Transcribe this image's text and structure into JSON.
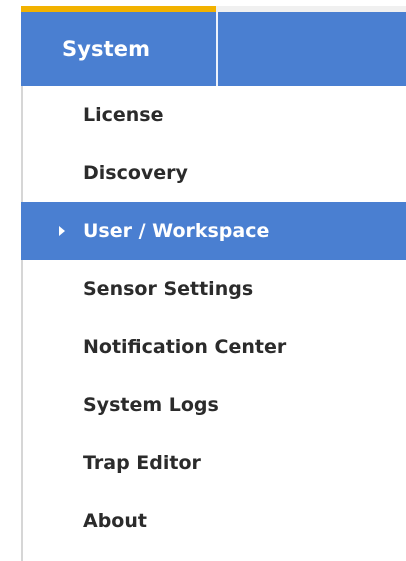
{
  "header": {
    "title": "System"
  },
  "menu": {
    "items": [
      {
        "label": "License",
        "active": false
      },
      {
        "label": "Discovery",
        "active": false
      },
      {
        "label": "User / Workspace",
        "active": true
      },
      {
        "label": "Sensor Settings",
        "active": false
      },
      {
        "label": "Notification Center",
        "active": false
      },
      {
        "label": "System Logs",
        "active": false
      },
      {
        "label": "Trap Editor",
        "active": false
      },
      {
        "label": "About",
        "active": false
      }
    ]
  },
  "colors": {
    "accent": "#4a7fd1",
    "highlight_strip": "#f2b200"
  },
  "icons": {
    "active_indicator": "chevron-right-icon"
  }
}
